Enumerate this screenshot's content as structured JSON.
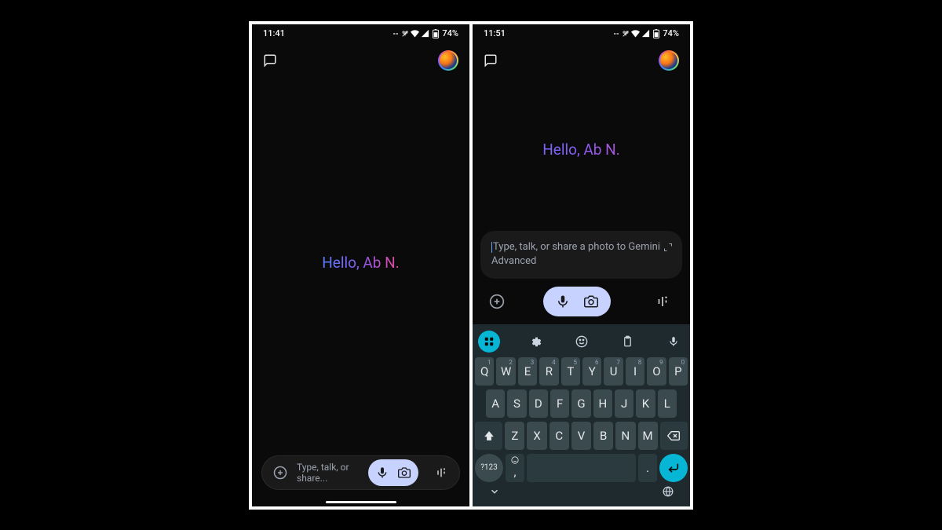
{
  "phone1": {
    "status": {
      "time": "11:41",
      "battery": "74%"
    },
    "greeting": "Hello, Ab N.",
    "input": {
      "placeholder": "Type, talk, or share..."
    }
  },
  "phone2": {
    "status": {
      "time": "11:51",
      "battery": "74%"
    },
    "greeting": "Hello, Ab N.",
    "input": {
      "placeholder": "Type, talk, or share a photo to Gemini Advanced"
    },
    "keyboard": {
      "row1": [
        {
          "k": "Q",
          "n": "1"
        },
        {
          "k": "W",
          "n": "2"
        },
        {
          "k": "E",
          "n": "3"
        },
        {
          "k": "R",
          "n": "4"
        },
        {
          "k": "T",
          "n": "5"
        },
        {
          "k": "Y",
          "n": "6"
        },
        {
          "k": "U",
          "n": "7"
        },
        {
          "k": "I",
          "n": "8"
        },
        {
          "k": "O",
          "n": "9"
        },
        {
          "k": "P",
          "n": "0"
        }
      ],
      "row2": [
        "A",
        "S",
        "D",
        "F",
        "G",
        "H",
        "J",
        "K",
        "L"
      ],
      "row3": [
        "Z",
        "X",
        "C",
        "V",
        "B",
        "N",
        "M"
      ],
      "symbol_key": "?123",
      "comma": ",",
      "period": "."
    }
  }
}
